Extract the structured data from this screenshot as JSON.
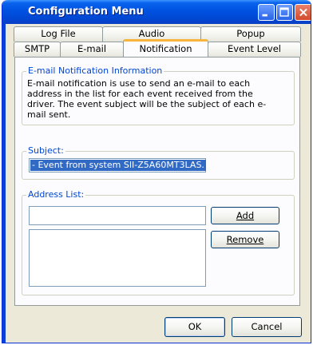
{
  "window": {
    "title": "Configuration Menu"
  },
  "tabs": {
    "row_back": [
      "Log File",
      "Audio",
      "Popup"
    ],
    "row_front": [
      "SMTP",
      "E-mail",
      "Notification",
      "Event Level"
    ],
    "active": "Notification"
  },
  "info_group": {
    "legend": "E-mail Notification Information",
    "text": "E-mail notification is use to send an e-mail to each address in the list for each event received from the driver. The event subject will be the subject of each e-mail sent."
  },
  "subject_group": {
    "legend": "Subject:",
    "value": "- Event from system SII-Z5A60MT3LAS."
  },
  "address_group": {
    "legend": "Address List:",
    "input_value": "",
    "add_label": "Add",
    "remove_label": "Remove",
    "items": []
  },
  "buttons": {
    "ok": "OK",
    "cancel": "Cancel"
  },
  "icons": {
    "minimize": "minimize-icon",
    "maximize": "maximize-icon",
    "close": "close-icon"
  },
  "colors": {
    "titlebar": "#0054e3",
    "active_tab_accent": "#f9b53b",
    "group_legend": "#0046d5",
    "selection": "#316ac5"
  }
}
